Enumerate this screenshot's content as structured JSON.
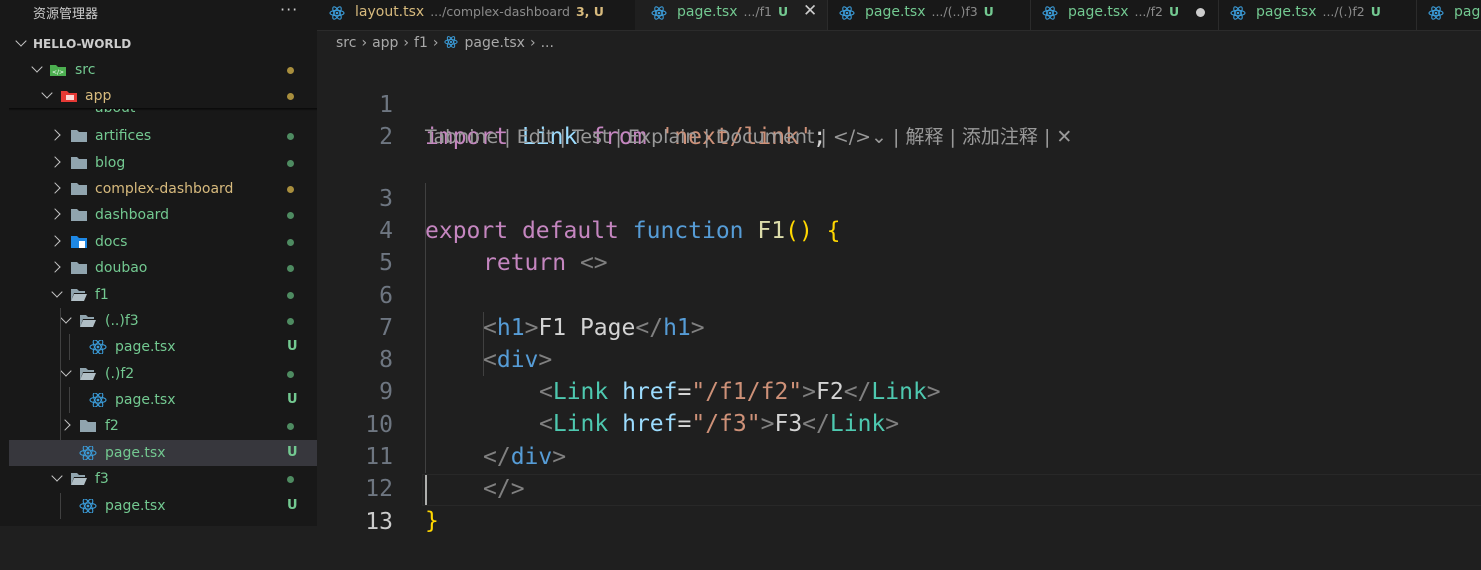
{
  "sidebar": {
    "title": "资源管理器",
    "more_label": "···",
    "root": "HELLO-WORLD",
    "items": [
      {
        "label": "src",
        "status": "dot-yellow"
      },
      {
        "label": "app",
        "status": "dot-yellow"
      },
      {
        "label": "about",
        "status": "dot-green"
      },
      {
        "label": "artifices",
        "status": "dot-green"
      },
      {
        "label": "blog",
        "status": "dot-green"
      },
      {
        "label": "complex-dashboard",
        "status": "dot-yellow"
      },
      {
        "label": "dashboard",
        "status": "dot-green"
      },
      {
        "label": "docs",
        "status": "dot-green"
      },
      {
        "label": "doubao",
        "status": "dot-green"
      },
      {
        "label": "f1",
        "status": "dot-green"
      },
      {
        "label": "(..)f3",
        "status": "dot-green"
      },
      {
        "label": "page.tsx",
        "status": "U"
      },
      {
        "label": "(.)f2",
        "status": "dot-green"
      },
      {
        "label": "page.tsx",
        "status": "U"
      },
      {
        "label": "f2",
        "status": "dot-green"
      },
      {
        "label": "page.tsx",
        "status": "U"
      },
      {
        "label": "f3",
        "status": "dot-green"
      },
      {
        "label": "page.tsx",
        "status": "U"
      }
    ]
  },
  "tabs": [
    {
      "name": "layout.tsx",
      "desc": ".../complex-dashboard",
      "badge": "3, U",
      "active": false
    },
    {
      "name": "page.tsx",
      "desc": ".../f1",
      "badge": "U",
      "active": true,
      "close": "✕"
    },
    {
      "name": "page.tsx",
      "desc": ".../(..)f3",
      "badge": "U",
      "active": false
    },
    {
      "name": "page.tsx",
      "desc": ".../f2",
      "badge": "U",
      "active": false
    },
    {
      "name": "page.tsx",
      "desc": ".../(.)f2",
      "badge": "U",
      "active": false
    },
    {
      "name": "pag",
      "desc": "",
      "badge": "",
      "active": false
    }
  ],
  "breadcrumb": [
    "src",
    "app",
    "f1",
    "page.tsx",
    "..."
  ],
  "editor": {
    "line_numbers": [
      "1",
      "2",
      "3",
      "4",
      "5",
      "6",
      "7",
      "8",
      "9",
      "10",
      "11",
      "12",
      "13"
    ],
    "codelens": "Tabnine | Edit | Test | Explain | Document | </>⌄ | 解释 | 添加注释 | ✕",
    "code": {
      "l1": {
        "kw": "import",
        "id": "Link",
        "from": "from",
        "str": "'next/link'",
        "semi": ";"
      },
      "l3": {
        "kw1": "export",
        "kw2": "default",
        "kw3": "function",
        "fn": "F1",
        "paren": "()",
        "brace": "{"
      },
      "l4": {
        "kw": "return",
        "frag": "<>"
      },
      "l6": {
        "open_lt": "<",
        "tag": "h1",
        "gt": ">",
        "text": "F1 Page",
        "close_lt": "</",
        "close_tag": "h1",
        "close_gt": ">"
      },
      "l7": {
        "lt": "<",
        "tag": "div",
        "gt": ">"
      },
      "l8": {
        "lt": "<",
        "comp": "Link",
        "attr": "href",
        "eq": "=",
        "str": "\"/f1/f2\"",
        "gt": ">",
        "text": "F2",
        "clt": "</",
        "ccomp": "Link",
        "cgt": ">"
      },
      "l9": {
        "lt": "<",
        "comp": "Link",
        "attr": "href",
        "eq": "=",
        "str": "\"/f3\"",
        "gt": ">",
        "text": "F3",
        "clt": "</",
        "ccomp": "Link",
        "cgt": ">"
      },
      "l10": {
        "lt": "</",
        "tag": "div",
        "gt": ">"
      },
      "l11": {
        "frag": "</>"
      },
      "l12": {
        "brace": "}"
      }
    }
  },
  "colors": {
    "git_untracked": "#73c991",
    "git_modified": "#d7ba7d",
    "react_icon": "#3b9cd9"
  }
}
